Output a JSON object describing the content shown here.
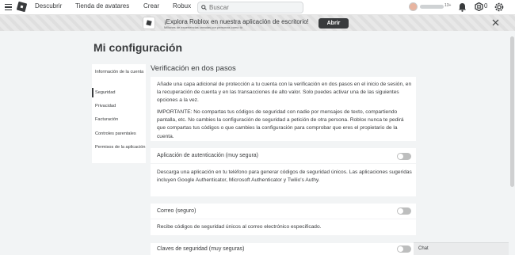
{
  "topbar": {
    "nav": [
      "Descubrir",
      "Tienda de avatares",
      "Crear",
      "Robux"
    ],
    "search_placeholder": "Buscar",
    "age_label": "13+",
    "robux_count": "0"
  },
  "banner": {
    "title": "¡Explora Roblox en nuestra aplicación de escritorio!",
    "subtitle": "Millones de experiencias creadas por personas como tú",
    "button": "Abrir"
  },
  "page": {
    "title": "Mi configuración"
  },
  "sidebar": {
    "items": [
      {
        "label": "Información de la cuenta"
      },
      {
        "label": "Seguridad"
      },
      {
        "label": "Privacidad"
      },
      {
        "label": "Facturación"
      },
      {
        "label": "Controles parentales"
      },
      {
        "label": "Permisos de la aplicación"
      }
    ]
  },
  "main": {
    "section_title": "Verificación en dos pasos",
    "intro": "Añade una capa adicional de protección a tu cuenta con la verificación en dos pasos en el inicio de sesión, en la recuperación de cuenta y en las transacciones de alto valor. Solo puedes activar una de las siguientes opciones a la vez.",
    "important": "IMPORTANTE: No compartas tus códigos de seguridad con nadie por mensajes de texto, compartiendo pantalla, etc. No cambies la configuración de seguridad a petición de otra persona. Roblox nunca te pedirá que compartas tus códigos o que cambies la configuración para comprobar que eres el propietario de la cuenta.",
    "options": [
      {
        "label": "Aplicación de autenticación (muy segura)",
        "description": "Descarga una aplicación en tu teléfono para generar códigos de seguridad únicos. Las aplicaciones sugeridas incluyen Google Authenticator, Microsoft Authenticator y Twilio's Authy.",
        "enabled": false
      },
      {
        "label": "Correo (seguro)",
        "description": "Recibe códigos de seguridad únicos al correo electrónico especificado.",
        "enabled": false
      },
      {
        "label": "Claves de seguridad (muy seguras)",
        "enabled": false
      }
    ]
  },
  "chat": {
    "label": "Chat"
  }
}
